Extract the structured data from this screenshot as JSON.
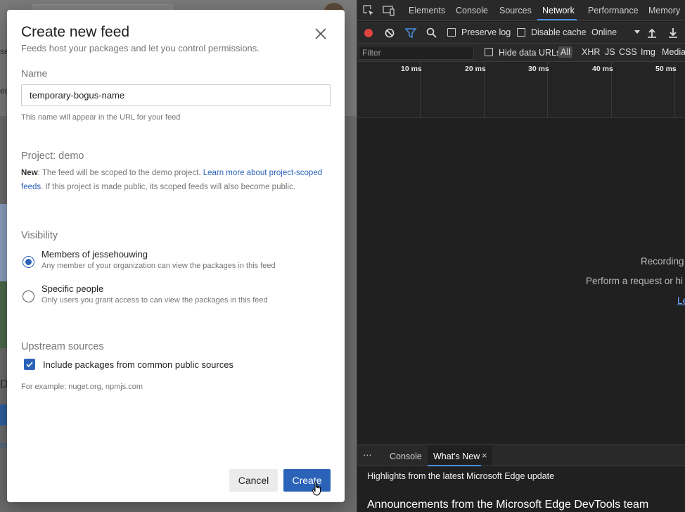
{
  "background_page": {
    "texts": [
      "se",
      "ed",
      "D",
      "m"
    ]
  },
  "dialog": {
    "title": "Create new feed",
    "subtitle": "Feeds host your packages and let you control permissions.",
    "name": {
      "label": "Name",
      "value": "temporary-bogus-name",
      "hint": "This name will appear in the URL for your feed"
    },
    "project": {
      "label": "Project: demo",
      "badge": "New",
      "text_before": ": The feed will be scoped to the demo project. ",
      "link": "Learn more about project-scoped feeds",
      "text_after": ". If this project is made public, its scoped feeds will also become public."
    },
    "visibility": {
      "label": "Visibility",
      "options": [
        {
          "label": "Members of jessehouwing",
          "desc": "Any member of your organization can view the packages in this feed",
          "selected": true
        },
        {
          "label": "Specific people",
          "desc": "Only users you grant access to can view the packages in this feed",
          "selected": false
        }
      ]
    },
    "upstream": {
      "label": "Upstream sources",
      "checkbox_label": "Include packages from common public sources",
      "checked": true,
      "example": "For example: nuget.org, npmjs.com"
    },
    "buttons": {
      "cancel": "Cancel",
      "create": "Create"
    },
    "accent_color": "#2b63b8"
  },
  "devtools": {
    "tabs": [
      "Elements",
      "Console",
      "Sources",
      "Network",
      "Performance",
      "Memory"
    ],
    "active_tab": "Network",
    "toolbar": {
      "preserve_log": "Preserve log",
      "disable_cache": "Disable cache",
      "throttle": "Online"
    },
    "filter": {
      "placeholder": "Filter",
      "hide_data_urls": "Hide data URLs",
      "types": [
        "All",
        "XHR",
        "JS",
        "CSS",
        "Img",
        "Media"
      ],
      "active_type": "All"
    },
    "timeline_ticks": [
      "10 ms",
      "20 ms",
      "30 ms",
      "40 ms",
      "50 ms"
    ],
    "empty_state": {
      "line1": "Recording",
      "line2": "Perform a request or hi",
      "link": "Le"
    },
    "drawer": {
      "more": "⋯",
      "tabs": [
        "Console",
        "What's New"
      ],
      "active_tab": "What's New",
      "close": "×",
      "highlights": "Highlights from the latest Microsoft Edge update",
      "announcement": "Announcements from the Microsoft Edge DevTools team"
    }
  }
}
